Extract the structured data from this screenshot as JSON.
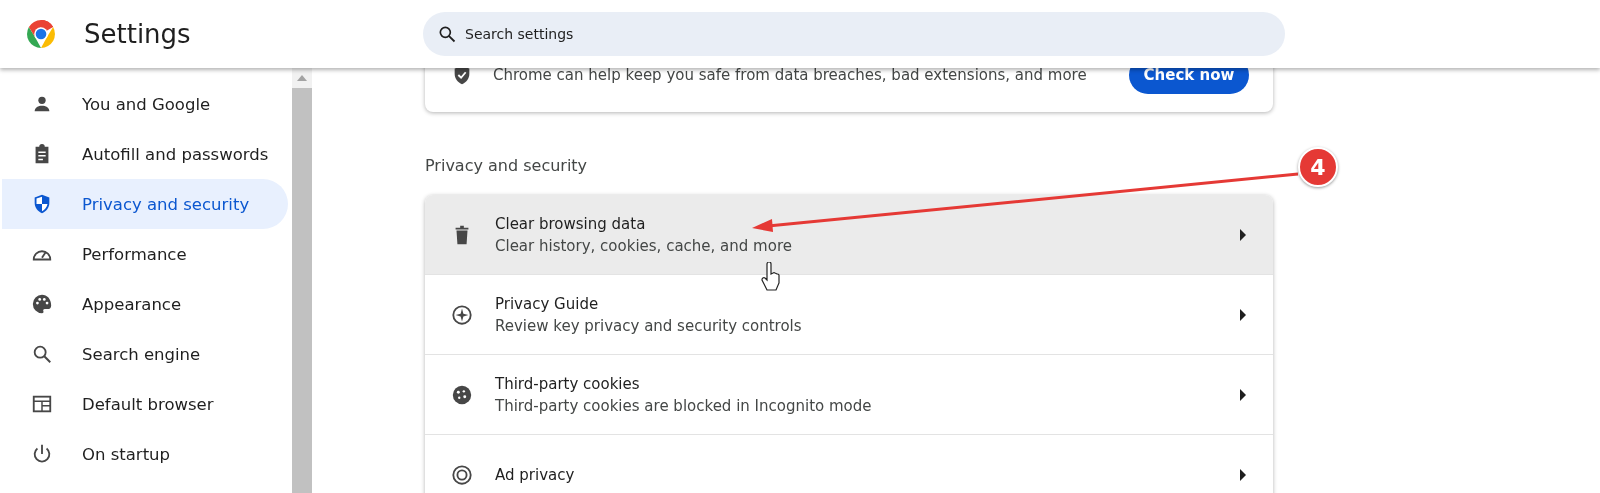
{
  "header": {
    "title": "Settings",
    "search": {
      "placeholder": "Search settings"
    }
  },
  "sidebar": {
    "items": [
      {
        "label": "You and Google",
        "kind": "person",
        "selected": false
      },
      {
        "label": "Autofill and passwords",
        "kind": "clipboard",
        "selected": false
      },
      {
        "label": "Privacy and security",
        "kind": "shield",
        "selected": true
      },
      {
        "label": "Performance",
        "kind": "gauge",
        "selected": false
      },
      {
        "label": "Appearance",
        "kind": "palette",
        "selected": false
      },
      {
        "label": "Search engine",
        "kind": "search",
        "selected": false
      },
      {
        "label": "Default browser",
        "kind": "browser",
        "selected": false
      },
      {
        "label": "On startup",
        "kind": "power",
        "selected": false
      }
    ]
  },
  "safety_card": {
    "text": "Chrome can help keep you safe from data breaches, bad extensions, and more",
    "button": "Check now"
  },
  "section": {
    "title": "Privacy and security",
    "rows": [
      {
        "kind": "trash",
        "title": "Clear browsing data",
        "subtitle": "Clear history, cookies, cache, and more",
        "hovered": true
      },
      {
        "kind": "compass",
        "title": "Privacy Guide",
        "subtitle": "Review key privacy and security controls",
        "hovered": false
      },
      {
        "kind": "cookie",
        "title": "Third-party cookies",
        "subtitle": "Third-party cookies are blocked in Incognito mode",
        "hovered": false
      },
      {
        "kind": "ad",
        "title": "Ad privacy",
        "hovered": false
      }
    ]
  },
  "annotation": {
    "label": "4"
  }
}
